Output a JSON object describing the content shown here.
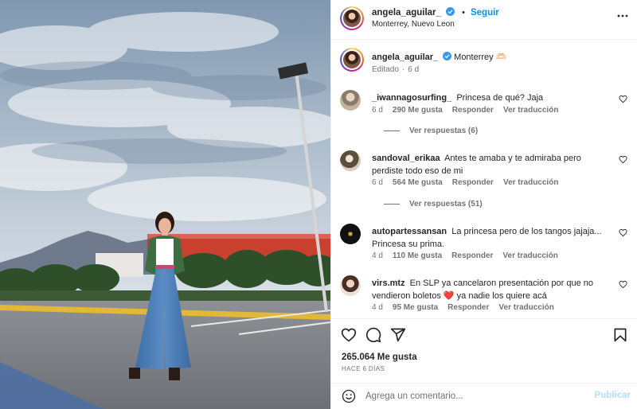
{
  "post": {
    "username": "angela_aguilar_",
    "follow_label": "Seguir",
    "separator": "•",
    "location": "Monterrey, Nuevo Leon",
    "more_icon": "more-horizontal-icon"
  },
  "caption": {
    "username": "angela_aguilar_",
    "text": "Monterrey 🫶🏻",
    "edited": "Editado",
    "separator": "·",
    "time": "6 d"
  },
  "comments": [
    {
      "username": "_iwannagosurfing_",
      "text": "Princesa de qué? Jaja",
      "time": "6 d",
      "likes": "290 Me gusta",
      "reply": "Responder",
      "translate": "Ver traducción",
      "view_replies": "Ver respuestas (6)"
    },
    {
      "username": "sandoval_erikaa",
      "text": "Antes te amaba y te admiraba pero perdiste todo eso de mi",
      "time": "6 d",
      "likes": "564 Me gusta",
      "reply": "Responder",
      "translate": "Ver traducción",
      "view_replies": "Ver respuestas (51)"
    },
    {
      "username": "autopartessansan",
      "text": "La princesa pero de los tangos jajaja... Princesa su prima.",
      "time": "4 d",
      "likes": "110 Me gusta",
      "reply": "Responder",
      "translate": "Ver traducción"
    },
    {
      "username": "virs.mtz",
      "text": "En SLP ya cancelaron presentación por que no vendieron boletos ❤️ ya nadie los quiere acá",
      "time": "4 d",
      "likes": "95 Me gusta",
      "reply": "Responder",
      "translate": "Ver traducción"
    }
  ],
  "actions": {
    "icons": [
      "heart-icon",
      "comment-icon",
      "share-icon",
      "bookmark-icon"
    ],
    "likes": "265.064 Me gusta",
    "time_ago": "HACE 6 DÍAS"
  },
  "composer": {
    "placeholder": "Agrega un comentario...",
    "publish": "Publicar",
    "emoji_icon": "emoji-smile-icon"
  },
  "colors": {
    "accent": "#0095f6",
    "publish_disabled": "#b2dffc",
    "secondary_text": "#737373",
    "verified": "#3897f0"
  }
}
